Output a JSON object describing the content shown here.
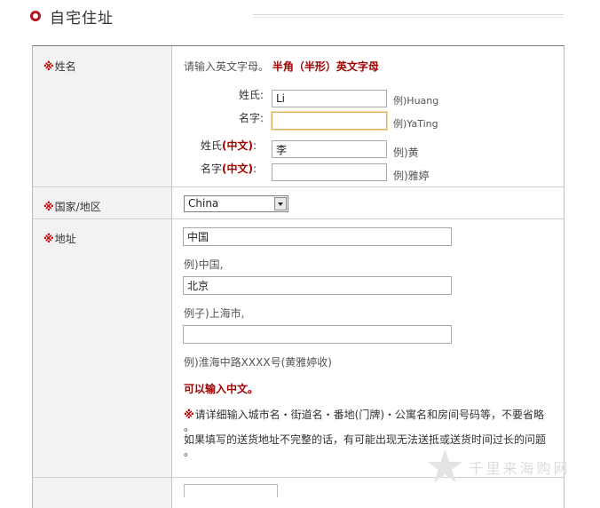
{
  "header": {
    "title": "自宅住址"
  },
  "required_mark": "※",
  "name_row": {
    "label": "姓名",
    "note_plain": "请输入英文字母。",
    "note_red": "半角（半形）英文字母",
    "fields": [
      {
        "label": "姓氏:",
        "value": "Li",
        "example": "例)Huang"
      },
      {
        "label": "名字:",
        "value": "",
        "example": "例)YaTing"
      }
    ],
    "cn_fields": [
      {
        "label_pre": "姓氏",
        "label_red": "(中文)",
        "label_post": ":",
        "value": "李",
        "example": "例)黄"
      },
      {
        "label_pre": "名字",
        "label_red": "(中文)",
        "label_post": ":",
        "value": "",
        "example": "例)雅婷"
      }
    ]
  },
  "country_row": {
    "label": "国家/地区",
    "selected": "China"
  },
  "address_row": {
    "label": "地址",
    "field1_value": "中国",
    "example1": "例)中国,",
    "field2_value": "北京",
    "example2": "例子)上海市,",
    "field3_value": "",
    "example3": "例)淮海中路XXXX号(黄雅婷收)",
    "chinese_ok": "可以输入中文。",
    "warn_mark": "※",
    "warn_line1": "请详细输入城市名・街道名・番地(门牌)・公寓名和房间号码等，不要省略",
    "warn_line1_end": "。",
    "warn_line2": "如果填写的送货地址不完整的话，有可能出现无法送抵或送货时间过长的问题",
    "warn_line2_end": "。"
  },
  "watermark": {
    "icon": "star-icon",
    "text": "千里来海购网"
  }
}
